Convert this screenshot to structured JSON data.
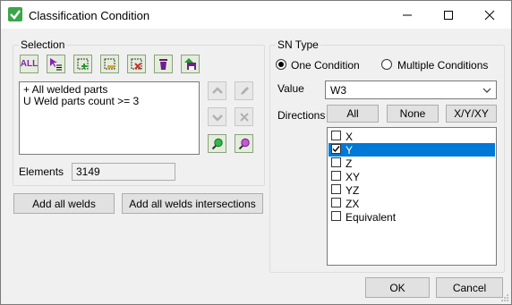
{
  "window": {
    "title": "Classification Condition"
  },
  "selection": {
    "legend": "Selection",
    "toolbar": [
      {
        "name": "all-tool-button",
        "label": "ALL"
      },
      {
        "name": "select-list-tool-button"
      },
      {
        "name": "add-selection-tool-button"
      },
      {
        "name": "select-region-tool-button"
      },
      {
        "name": "remove-selection-tool-button"
      },
      {
        "name": "delete-tool-button"
      },
      {
        "name": "save-selection-tool-button"
      }
    ],
    "lines": [
      "+ All welded parts",
      "U Weld parts count >= 3"
    ],
    "elements_label": "Elements",
    "elements_value": "3149",
    "add_all_welds": "Add all welds",
    "add_all_intersections": "Add all welds intersections"
  },
  "sn_type": {
    "legend": "SN Type",
    "one_condition": "One Condition",
    "multiple_conditions": "Multiple Conditions",
    "selected_mode": "one",
    "value_label": "Value",
    "value_selected": "W3",
    "directions_label": "Directions",
    "btn_all": "All",
    "btn_none": "None",
    "btn_xyz": "X/Y/XY",
    "directions": [
      {
        "label": "X",
        "checked": false,
        "selected": false
      },
      {
        "label": "Y",
        "checked": true,
        "selected": true
      },
      {
        "label": "Z",
        "checked": false,
        "selected": false
      },
      {
        "label": "XY",
        "checked": false,
        "selected": false
      },
      {
        "label": "YZ",
        "checked": false,
        "selected": false
      },
      {
        "label": "ZX",
        "checked": false,
        "selected": false
      },
      {
        "label": "Equivalent",
        "checked": false,
        "selected": false
      }
    ]
  },
  "footer": {
    "ok": "OK",
    "cancel": "Cancel"
  },
  "colors": {
    "accent_selection": "#0078d7",
    "check_green": "#3aa64a",
    "tool_purple": "#8a1fb5"
  }
}
